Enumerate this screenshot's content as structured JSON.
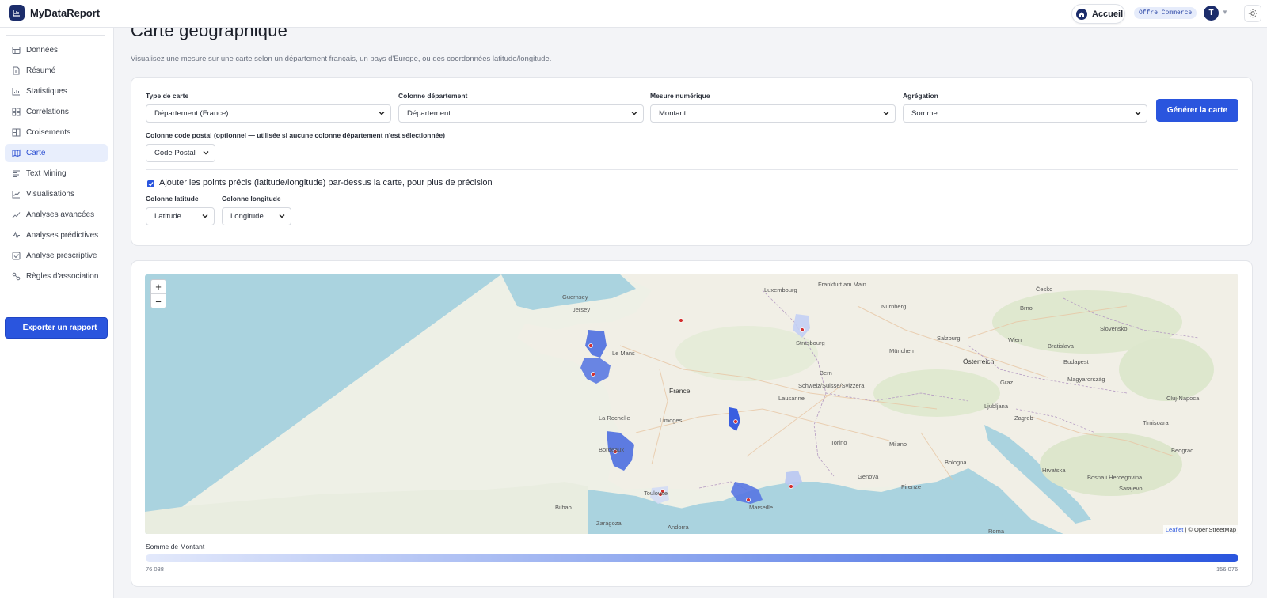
{
  "app": {
    "name": "MyDataReport"
  },
  "header": {
    "home_label": "Accueil",
    "offer_badge": "Offre Commerce",
    "avatar_initial": "T"
  },
  "sidebar": {
    "items": [
      {
        "label": "Données",
        "icon": "table-icon"
      },
      {
        "label": "Résumé",
        "icon": "document-icon"
      },
      {
        "label": "Statistiques",
        "icon": "bar-chart-icon"
      },
      {
        "label": "Corrélations",
        "icon": "grid-icon"
      },
      {
        "label": "Croisements",
        "icon": "layout-icon"
      },
      {
        "label": "Carte",
        "icon": "map-icon",
        "active": true
      },
      {
        "label": "Text Mining",
        "icon": "text-icon"
      },
      {
        "label": "Visualisations",
        "icon": "line-chart-icon"
      },
      {
        "label": "Analyses avancées",
        "icon": "trend-icon"
      },
      {
        "label": "Analyses prédictives",
        "icon": "activity-icon"
      },
      {
        "label": "Analyse prescriptive",
        "icon": "check-square-icon"
      },
      {
        "label": "Règles d'association",
        "icon": "link-icon"
      }
    ],
    "export_label": "Exporter un rapport"
  },
  "page": {
    "title": "Carte géographique",
    "subtitle": "Visualisez une mesure sur une carte selon un département français, un pays d'Europe, ou des coordonnées latitude/longitude."
  },
  "form": {
    "map_type": {
      "label": "Type de carte",
      "value": "Département (France)"
    },
    "dept_column": {
      "label": "Colonne département",
      "value": "Département"
    },
    "measure": {
      "label": "Mesure numérique",
      "value": "Montant"
    },
    "aggregation": {
      "label": "Agrégation",
      "value": "Somme"
    },
    "generate_label": "Générer la carte",
    "postal": {
      "label": "Colonne code postal (optionnel — utilisée si aucune colonne département n'est sélectionnée)",
      "value": "Code Postal"
    },
    "precise_points": {
      "label": "Ajouter les points précis (latitude/longitude) par-dessus la carte, pour plus de précision",
      "checked": true
    },
    "lat": {
      "label": "Colonne latitude",
      "value": "Latitude"
    },
    "lon": {
      "label": "Colonne longitude",
      "value": "Longitude"
    }
  },
  "map": {
    "zoom_in": "+",
    "zoom_out": "−",
    "attribution_leaflet": "Leaflet",
    "attribution_osm": "| © OpenStreetMap",
    "labels": [
      "Guernsey",
      "Jersey",
      "Le Mans",
      "Bordeaux",
      "Toulouse",
      "Marseille",
      "France",
      "Limoges",
      "La Rochelle",
      "Frankfurt am Main",
      "Nürnberg",
      "München",
      "Wien",
      "Bratislava",
      "Budapest",
      "Österreich",
      "Slovensko",
      "Magyarország",
      "Zagreb",
      "Hrvatska",
      "Beograd",
      "Firenze",
      "Roma",
      "Bologna",
      "Genova",
      "Milano",
      "Schweiz/Suisse/Svizzera",
      "Bern",
      "Lausanne",
      "Torino",
      "Andorra",
      "Zaragoza",
      "Bilbao",
      "Salzburg",
      "Graz",
      "Ljubljana",
      "Bosna i Hercegovina",
      "Sarajevo",
      "Cluj-Napoca",
      "Timișoara",
      "Brno",
      "Česko",
      "Luxembourg",
      "Strasbourg"
    ]
  },
  "legend": {
    "title": "Somme de Montant",
    "min": "76 038",
    "max": "156 076"
  },
  "colors": {
    "accent": "#2a55de",
    "brand": "#1c2d6b",
    "choropleth_high": "#3a5ee0",
    "choropleth_low": "#c8d4f5",
    "point": "#d32f2f"
  }
}
